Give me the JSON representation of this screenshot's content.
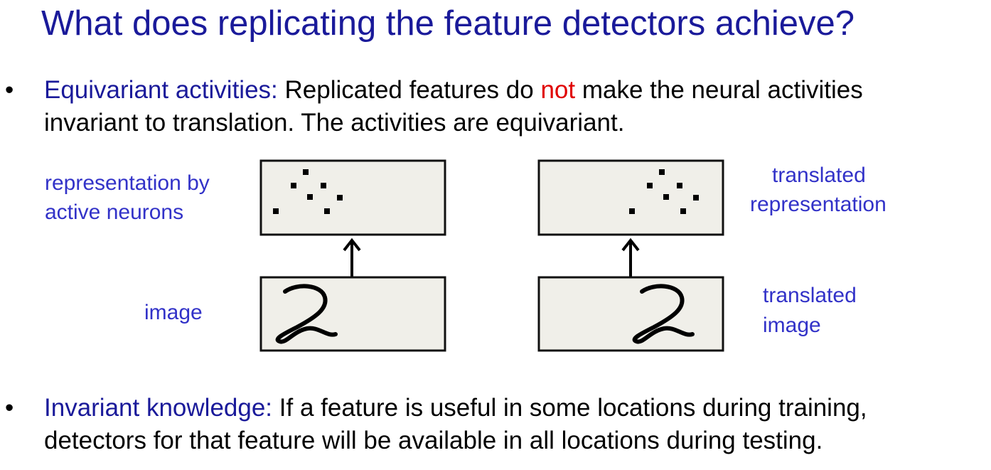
{
  "title": "What does replicating the feature detectors achieve?",
  "bullets": [
    {
      "marker": "•",
      "term": "Equivariant activities:",
      "text_before": " Replicated features do ",
      "highlight": "not",
      "text_line1_after": " make the neural activities",
      "text_line2": "invariant to translation. The activities are equivariant."
    },
    {
      "marker": "•",
      "term": "Invariant knowledge:",
      "text_line1": " If a feature is useful in some locations during training,",
      "text_line2": "detectors for that feature will be available in all locations during testing."
    }
  ],
  "diagram": {
    "labels": {
      "representation_line1": "representation by",
      "representation_line2": "active neurons",
      "image": "image",
      "translated_representation_line1": "translated",
      "translated_representation_line2": "representation",
      "translated_image_line1": "translated",
      "translated_image_line2": "image"
    },
    "digit": "2",
    "colors": {
      "title": "#1a1a9a",
      "label": "#3232c8",
      "highlight": "#e00000",
      "box_fill": "#f0efe9",
      "box_stroke": "#111111"
    }
  }
}
